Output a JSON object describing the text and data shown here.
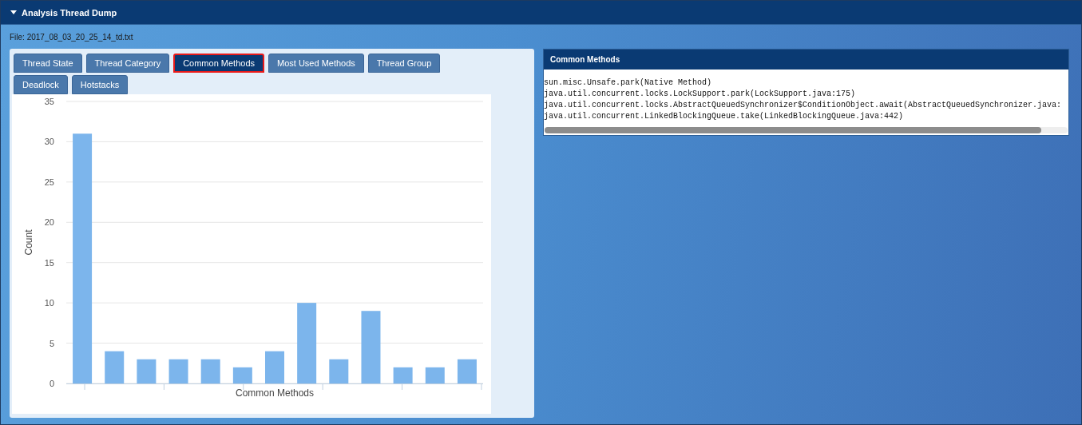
{
  "header": {
    "title": "Analysis Thread Dump",
    "expanded": true
  },
  "file_label": "File: 2017_08_03_20_25_14_td.txt",
  "tabs": [
    {
      "label": "Thread State",
      "selected": false
    },
    {
      "label": "Thread Category",
      "selected": false
    },
    {
      "label": "Common Methods",
      "selected": true
    },
    {
      "label": "Most Used Methods",
      "selected": false
    },
    {
      "label": "Thread Group",
      "selected": false
    },
    {
      "label": "Deadlock",
      "selected": false
    },
    {
      "label": "Hotstacks",
      "selected": false
    }
  ],
  "chart_data": {
    "type": "bar",
    "xlabel": "Common Methods",
    "ylabel": "Count",
    "ylim": [
      0,
      35
    ],
    "yticks": [
      0,
      5,
      10,
      15,
      20,
      25,
      30,
      35
    ],
    "grid": true,
    "values": [
      31,
      4,
      3,
      3,
      3,
      2,
      4,
      10,
      3,
      9,
      2,
      2,
      3
    ]
  },
  "methods_panel": {
    "title": "Common Methods",
    "lines": [
      "sun.misc.Unsafe.park(Native Method)",
      "java.util.concurrent.locks.LockSupport.park(LockSupport.java:175)",
      "java.util.concurrent.locks.AbstractQueuedSynchronizer$ConditionObject.await(AbstractQueuedSynchronizer.java:",
      "java.util.concurrent.LinkedBlockingQueue.take(LinkedBlockingQueue.java:442)"
    ]
  }
}
